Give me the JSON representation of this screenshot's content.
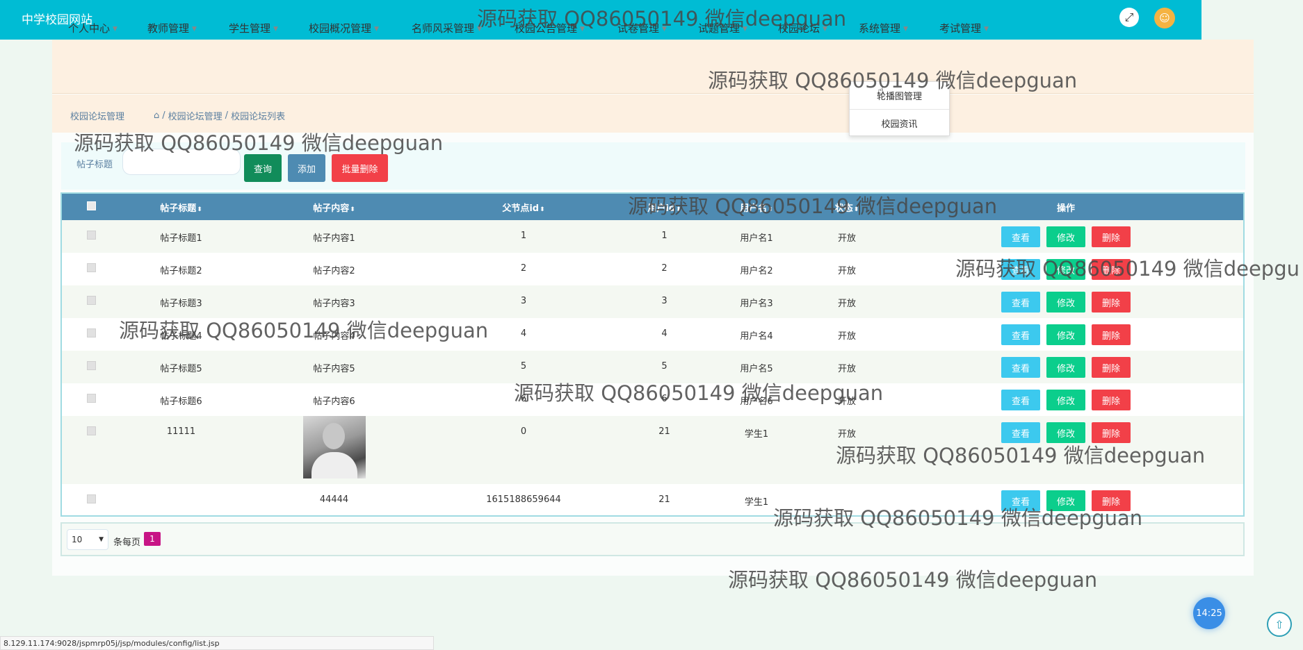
{
  "header": {
    "site_title": "中学校园网站",
    "fullscreen_icon": "⤢",
    "avatar_icon": "☺"
  },
  "nav": {
    "items": [
      {
        "label": "个人中心"
      },
      {
        "label": "教师管理"
      },
      {
        "label": "学生管理"
      },
      {
        "label": "校园概况管理"
      },
      {
        "label": "名师风采管理"
      },
      {
        "label": "校园公告管理"
      },
      {
        "label": "试卷管理"
      },
      {
        "label": "试题管理"
      },
      {
        "label": "校园论坛"
      },
      {
        "label": "系统管理"
      },
      {
        "label": "考试管理"
      }
    ],
    "dropdown": [
      "轮播图管理",
      "校园资讯"
    ]
  },
  "breadcrumb": {
    "root": "校园论坛管理",
    "home_icon": "⌂",
    "sep": "/",
    "level1": "校园论坛管理",
    "level2": "校园论坛列表"
  },
  "search": {
    "label": "帖子标题",
    "placeholder": "",
    "search_button": "查询",
    "add_button": "添加",
    "batch_delete_button": "批量删除"
  },
  "table": {
    "columns": [
      "帖子标题",
      "帖子内容",
      "父节点id",
      "用户id",
      "用户名",
      "状态",
      "操作"
    ],
    "actions": {
      "view": "查看",
      "edit": "修改",
      "delete": "删除"
    },
    "rows": [
      {
        "title": "帖子标题1",
        "content": "帖子内容1",
        "parent_id": "1",
        "user_id": "1",
        "username": "用户名1",
        "status": "开放"
      },
      {
        "title": "帖子标题2",
        "content": "帖子内容2",
        "parent_id": "2",
        "user_id": "2",
        "username": "用户名2",
        "status": "开放"
      },
      {
        "title": "帖子标题3",
        "content": "帖子内容3",
        "parent_id": "3",
        "user_id": "3",
        "username": "用户名3",
        "status": "开放"
      },
      {
        "title": "帖子标题4",
        "content": "帖子内容4",
        "parent_id": "4",
        "user_id": "4",
        "username": "用户名4",
        "status": "开放"
      },
      {
        "title": "帖子标题5",
        "content": "帖子内容5",
        "parent_id": "5",
        "user_id": "5",
        "username": "用户名5",
        "status": "开放"
      },
      {
        "title": "帖子标题6",
        "content": "帖子内容6",
        "parent_id": "6",
        "user_id": "6",
        "username": "用户名6",
        "status": "开放"
      },
      {
        "title": "11111",
        "content": "",
        "parent_id": "0",
        "user_id": "21",
        "username": "学生1",
        "status": "开放"
      },
      {
        "title": "",
        "content": "44444",
        "parent_id": "1615188659644",
        "user_id": "21",
        "username": "学生1",
        "status": ""
      }
    ]
  },
  "pagination": {
    "page_size": "10",
    "per_page_label": "条每页",
    "current_page": "1"
  },
  "watermark": "源码获取 QQ86050149 微信deepguan",
  "watermark_cut": "源码获取 QQ86050149 微信deepgu",
  "clock": "14:25",
  "to_top_icon": "⇧",
  "status_url": "8.129.11.174:9028/jspmrp05j/jsp/modules/config/list.jsp"
}
